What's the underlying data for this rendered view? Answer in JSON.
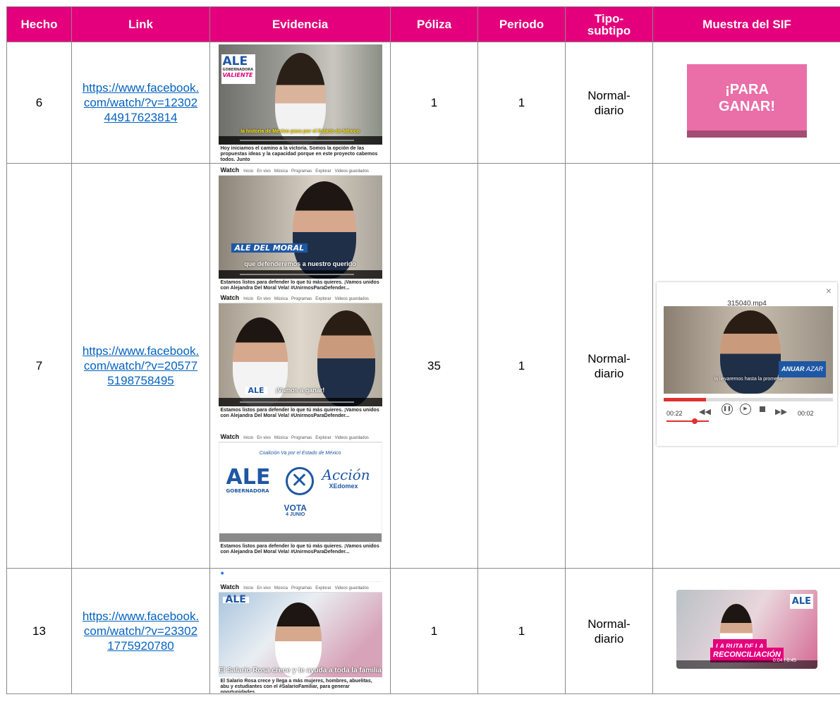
{
  "headers": {
    "hecho": "Hecho",
    "link": "Link",
    "evidencia": "Evidencia",
    "poliza": "Póliza",
    "periodo": "Periodo",
    "tipo": "Tipo-subtipo",
    "muestra": "Muestra del SIF"
  },
  "colors": {
    "header_bg": "#e4007c",
    "header_text": "#ffffff",
    "link": "#0563c1"
  },
  "rows": [
    {
      "hecho": "6",
      "link": "https://www.facebook.com/watch/?v=1230244917623814",
      "poliza": "1",
      "periodo": "1",
      "tipo": "Normal-diario",
      "evidence": {
        "logo_line1": "ALE",
        "logo_line2": "GOBERNADORA",
        "logo_line3": "VALIENTE",
        "caption": "la historia de México pasa por el Estado de México",
        "post": "Hoy iniciamos el camino a la victoria. Somos la opción de las propuestas ideas y la capacidad porque en este proyecto cabemos todos. Junto"
      },
      "sif": {
        "text": "¡PARA GANAR!"
      }
    },
    {
      "hecho": "7",
      "link": "https://www.facebook.com/watch/?v=205775198758495",
      "poliza": "35",
      "periodo": "1",
      "tipo": "Normal-diario",
      "evidence": {
        "nav": {
          "title": "Watch",
          "items": [
            "Inicio",
            "En vivo",
            "Música",
            "Programas",
            "Explorar",
            "Videos guardados"
          ]
        },
        "frame1_logo": "ALE DEL MORAL",
        "frame1_caption": "que defenderemos a nuestro querido",
        "frame1_post": "Estamos listos para defender lo que tú más quieres. ¡Vamos unidos con Alejandra Del Moral Vela! #UnirmosParaDefender...",
        "frame2_logo": "ALE",
        "frame2_caption": "¡Vamos a ganar!",
        "frame2_post": "Estamos listos para defender lo que tú más quieres. ¡Vamos unidos con Alejandra Del Moral Vela! #UnirmosParaDefender...",
        "frame3_coalicion": "Coalición Va por el Estado de México",
        "frame3_ale": "ALE",
        "frame3_gob": "GOBERNADORA",
        "frame3_accion": "Acción",
        "frame3_edomex": "XEdomex",
        "frame3_vota": "VOTA",
        "frame3_date": "4 JUNIO",
        "frame3_post": "Estamos listos para defender lo que tú más quieres. ¡Vamos unidos con Alejandra Del Moral Vela! #UnirmosParaDefender..."
      },
      "sif": {
        "filename": "315040.mp4",
        "close": "×",
        "name_bold": "ANUAR",
        "name_rest": "AZAR",
        "subtitle": "la llevaremos hasta la promesa",
        "time_start": "00:22",
        "time_end": "00:02"
      }
    },
    {
      "hecho": "13",
      "link": "https://www.facebook.com/watch/?v=233021775920780",
      "poliza": "1",
      "periodo": "1",
      "tipo": "Normal-diario",
      "evidence": {
        "nav": {
          "title": "Watch",
          "items": [
            "Inicio",
            "En vivo",
            "Música",
            "Programas",
            "Explorar",
            "Videos guardados"
          ]
        },
        "logo": "ALE",
        "caption": "El Salario Rosa crece y te ayuda a toda la familia",
        "post": "El Salario Rosa crece y llega a más mujeres, hombres, abuelitas, abu y estudiantes con el #SalarioFamiliar, para generar oportunidades"
      },
      "sif": {
        "logo": "ALE",
        "banner1": "LA RUTA DE LA",
        "banner2": "RECONCILIACIÓN",
        "time": "0:04 / 0:45"
      }
    }
  ]
}
